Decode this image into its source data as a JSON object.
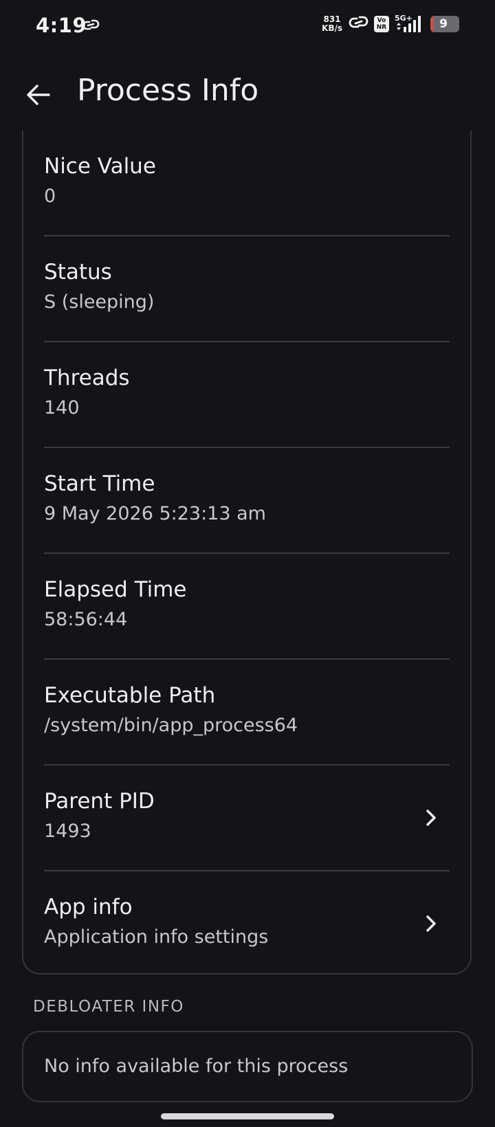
{
  "status_bar": {
    "time": "4:19",
    "net_speed_value": "831",
    "net_speed_unit": "KB/s",
    "volte_top": "Vo",
    "volte_bottom": "NR",
    "network_type": "5G+",
    "battery_level": "9",
    "battery_fraction": 0.09,
    "battery_low_color": "#e0453a",
    "icons": [
      "link-icon",
      "hotspot-icon",
      "volte-icon",
      "signal-icon",
      "battery-icon"
    ]
  },
  "app_bar": {
    "title": "Process Info",
    "back_icon": "arrow-back-icon"
  },
  "details": [
    {
      "label": "Nice Value",
      "value": "0",
      "chevron": false
    },
    {
      "label": "Status",
      "value": "S (sleeping)",
      "chevron": false
    },
    {
      "label": "Threads",
      "value": "140",
      "chevron": false
    },
    {
      "label": "Start Time",
      "value": "9 May 2026 5:23:13 am",
      "chevron": false
    },
    {
      "label": "Elapsed Time",
      "value": "58:56:44",
      "chevron": false
    },
    {
      "label": "Executable Path",
      "value": "/system/bin/app_process64",
      "chevron": false
    },
    {
      "label": "Parent PID",
      "value": "1493",
      "chevron": true
    },
    {
      "label": "App info",
      "value": "Application info settings",
      "chevron": true
    }
  ],
  "debloater": {
    "section_title": "DEBLOATER INFO",
    "message": "No info available for this process"
  },
  "colors": {
    "background": "#131418",
    "card_border": "#33353b",
    "divider": "#3a3c42"
  }
}
